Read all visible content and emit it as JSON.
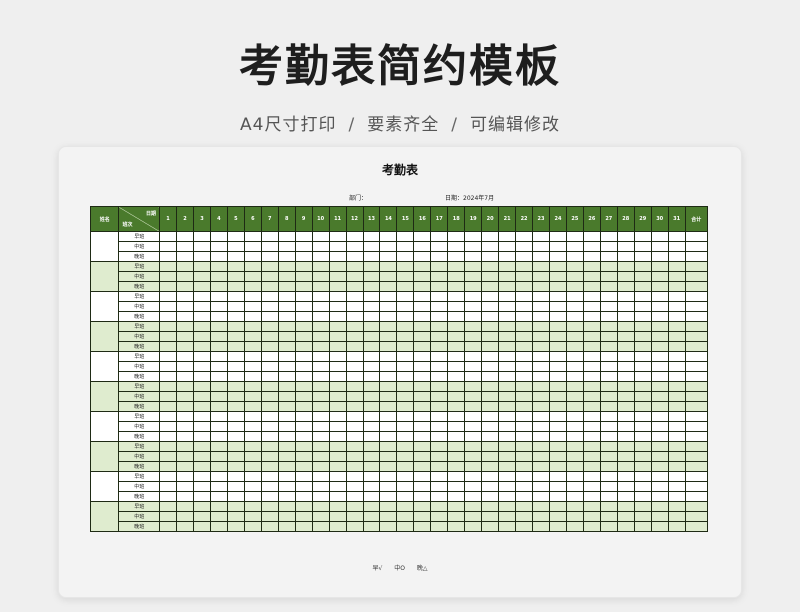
{
  "header": {
    "title": "考勤表简约模板",
    "subtitle_items": [
      "A4尺寸打印",
      "要素齐全",
      "可编辑修改"
    ],
    "separator": "/"
  },
  "sheet": {
    "title": "考勤表",
    "department_label": "部门：",
    "date_label": "日期：",
    "date_value": "2024年7月",
    "columns": {
      "name": "姓名",
      "diag_top": "日期",
      "diag_bottom": "班次",
      "days": [
        "1",
        "2",
        "3",
        "4",
        "5",
        "6",
        "7",
        "8",
        "9",
        "10",
        "11",
        "12",
        "13",
        "14",
        "15",
        "16",
        "17",
        "18",
        "19",
        "20",
        "21",
        "22",
        "23",
        "24",
        "25",
        "26",
        "27",
        "28",
        "29",
        "30",
        "31"
      ],
      "total": "合计"
    },
    "shifts": [
      "早班",
      "中班",
      "晚班"
    ],
    "employee_count": 10,
    "legend": [
      "早√",
      "中O",
      "晚△"
    ]
  },
  "colors": {
    "header_green": "#4a7a2c",
    "row_green": "#dfeccf",
    "row_white": "#ffffff"
  }
}
